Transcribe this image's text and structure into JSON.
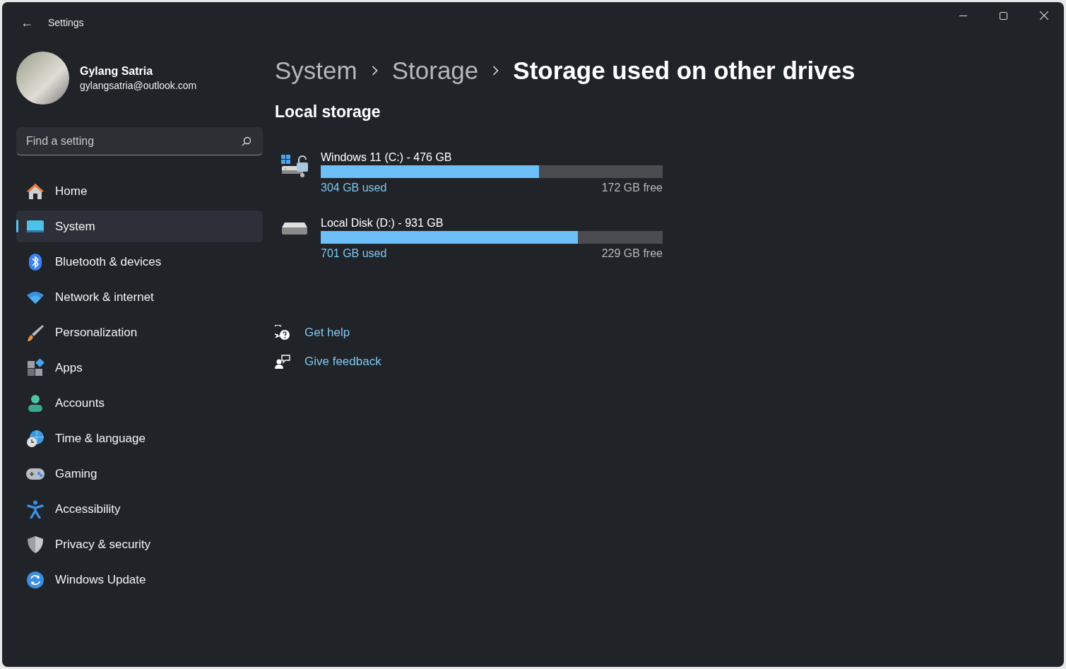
{
  "window": {
    "title": "Settings",
    "back_label": "←"
  },
  "profile": {
    "name": "Gylang Satria",
    "email": "gylangsatria@outlook.com"
  },
  "search": {
    "placeholder": "Find a setting"
  },
  "nav": [
    {
      "label": "Home",
      "selected": false
    },
    {
      "label": "System",
      "selected": true
    },
    {
      "label": "Bluetooth & devices",
      "selected": false
    },
    {
      "label": "Network & internet",
      "selected": false
    },
    {
      "label": "Personalization",
      "selected": false
    },
    {
      "label": "Apps",
      "selected": false
    },
    {
      "label": "Accounts",
      "selected": false
    },
    {
      "label": "Time & language",
      "selected": false
    },
    {
      "label": "Gaming",
      "selected": false
    },
    {
      "label": "Accessibility",
      "selected": false
    },
    {
      "label": "Privacy & security",
      "selected": false
    },
    {
      "label": "Windows Update",
      "selected": false
    }
  ],
  "breadcrumb": [
    "System",
    "Storage",
    "Storage used on other drives"
  ],
  "section_title": "Local storage",
  "drives": [
    {
      "name": "Windows 11 (C:) - 476 GB",
      "level": 0.639,
      "used": "304 GB used",
      "free": "172 GB free"
    },
    {
      "name": "Local Disk (D:) - 931 GB",
      "level": 0.753,
      "used": "701 GB used",
      "free": "229 GB free"
    }
  ],
  "help_links": [
    "Get help",
    "Give feedback"
  ]
}
